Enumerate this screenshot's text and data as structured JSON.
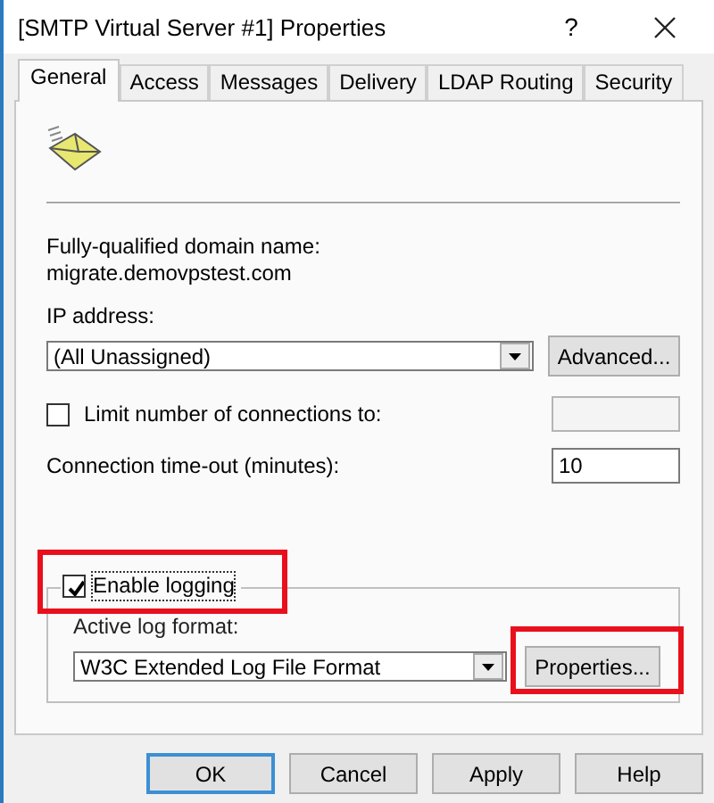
{
  "window": {
    "title": "[SMTP Virtual Server #1] Properties",
    "help": "?"
  },
  "tabs": [
    {
      "label": "General",
      "selected": true
    },
    {
      "label": "Access",
      "selected": false
    },
    {
      "label": "Messages",
      "selected": false
    },
    {
      "label": "Delivery",
      "selected": false
    },
    {
      "label": "LDAP Routing",
      "selected": false
    },
    {
      "label": "Security",
      "selected": false
    }
  ],
  "domain": {
    "label": "Fully-qualified domain name:",
    "value": "migrate.demovpstest.com"
  },
  "ip_address": {
    "label": "IP address:",
    "value": "(All Unassigned)",
    "button": "Advanced..."
  },
  "limit_connections": {
    "label": "Limit number of connections to:",
    "checked": false
  },
  "timeout": {
    "label": "Connection time-out (minutes):",
    "value": "10"
  },
  "logging": {
    "label": "Enable logging",
    "checked": true,
    "highlighted": true,
    "format_label": "Active log format:",
    "format": "W3C Extended Log File Format",
    "button": "Properties...",
    "button_highlighted": true
  },
  "buttons": [
    {
      "label": "OK",
      "default": true
    },
    {
      "label": "Cancel",
      "default": false
    },
    {
      "label": "Apply",
      "default": false
    },
    {
      "label": "Help",
      "default": false
    }
  ]
}
